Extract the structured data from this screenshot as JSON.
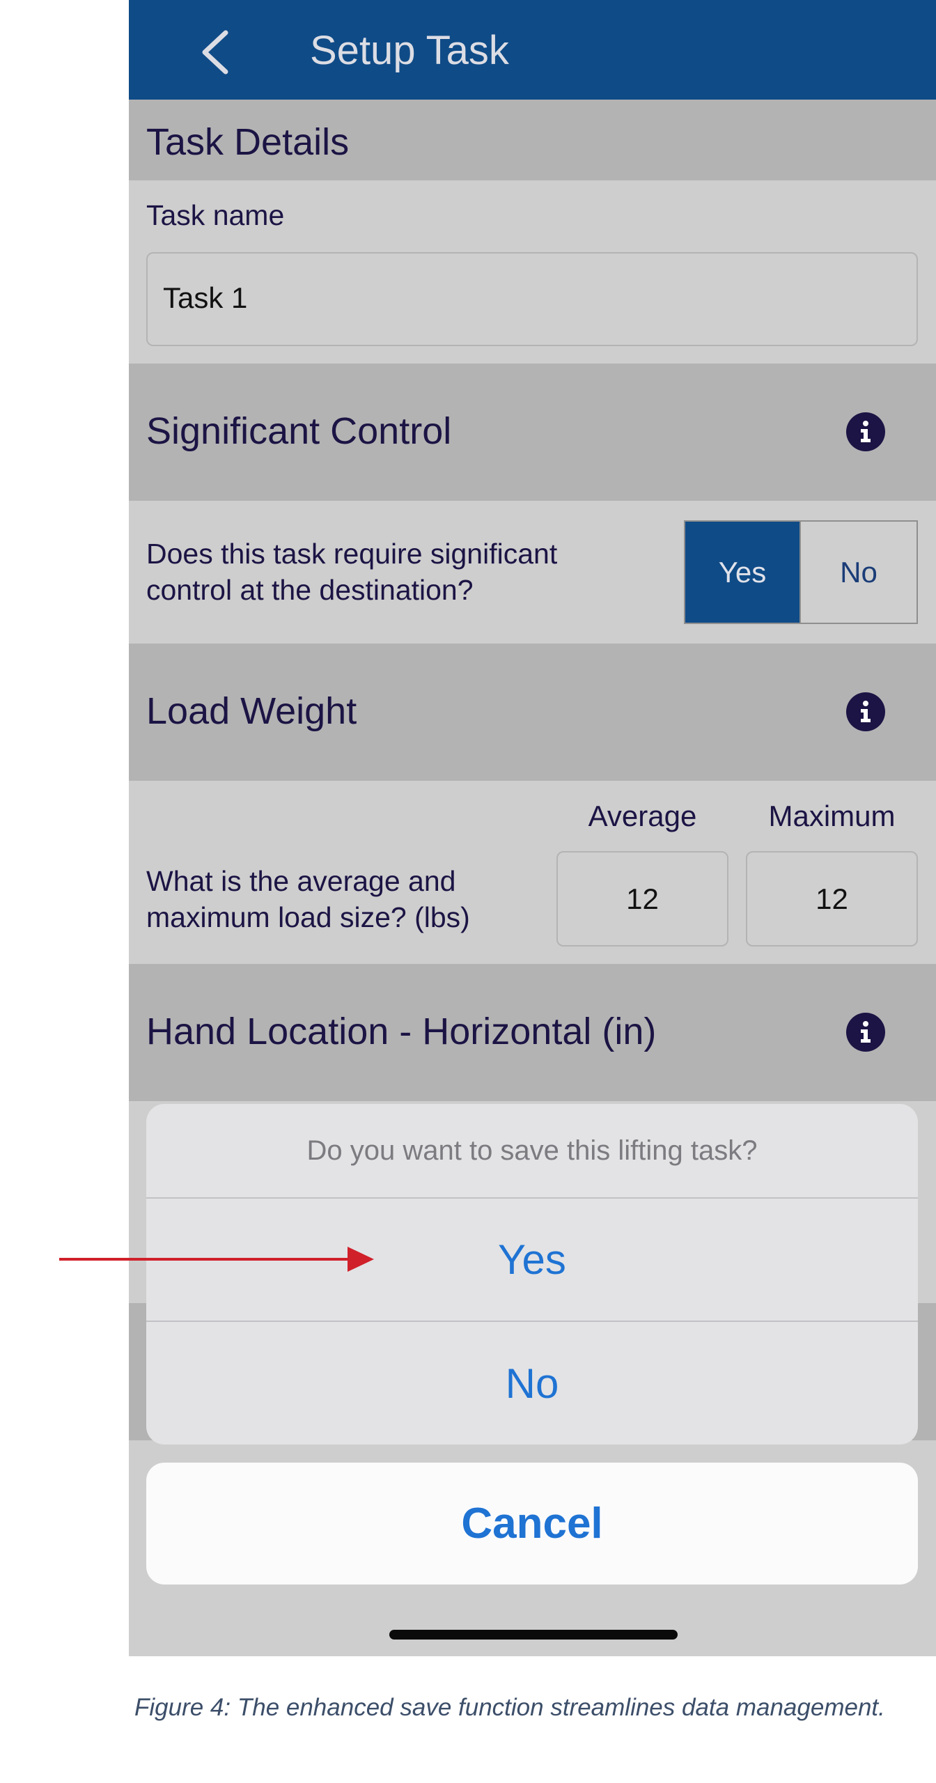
{
  "nav": {
    "title": "Setup Task",
    "back_icon": "chevron-left-icon"
  },
  "task_details": {
    "heading": "Task Details",
    "task_name_label": "Task name",
    "task_name_value": "Task 1"
  },
  "significant_control": {
    "heading": "Significant Control",
    "question": "Does this task require significant control at the destination?",
    "options": [
      "Yes",
      "No"
    ],
    "selected": "Yes"
  },
  "load_weight": {
    "heading": "Load Weight",
    "question": "What is the average and maximum load size? (lbs)",
    "col_average": "Average",
    "col_maximum": "Maximum",
    "average_value": "12",
    "maximum_value": "12"
  },
  "hand_location": {
    "heading": "Hand Location - Horizontal (in)"
  },
  "action_sheet": {
    "message": "Do you want to save this lifting task?",
    "yes": "Yes",
    "no": "No",
    "cancel": "Cancel"
  },
  "caption": "Figure 4: The enhanced save function streamlines data management.",
  "colors": {
    "nav": "#0f4b87",
    "accent": "#1f73d3",
    "arrow": "#d0202a"
  }
}
